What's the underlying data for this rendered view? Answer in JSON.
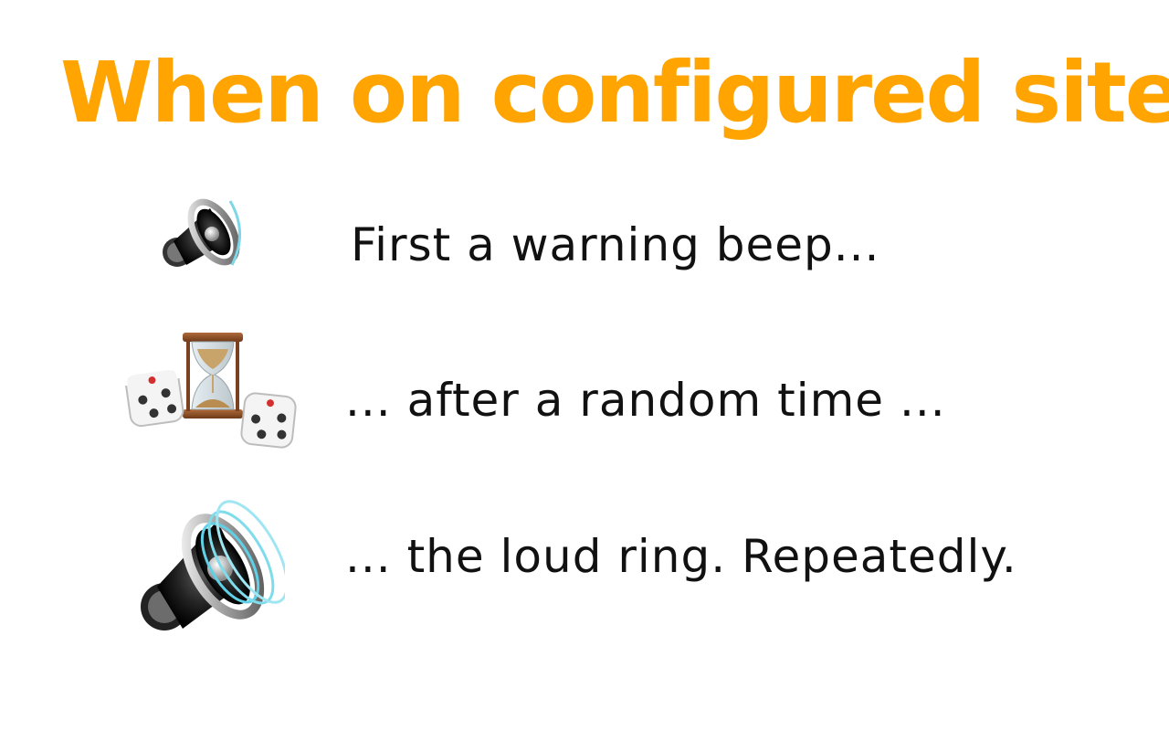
{
  "title": "When on configured site",
  "colors": {
    "title": "#FFA400",
    "text": "#111111"
  },
  "rows": [
    {
      "icon": "speaker-low-volume-icon",
      "text": "First a warning beep..."
    },
    {
      "icon": "dice-and-hourglass-icon",
      "text": "... after a random time ..."
    },
    {
      "icon": "speaker-high-volume-icon",
      "text": "... the loud ring. Repeatedly."
    }
  ]
}
